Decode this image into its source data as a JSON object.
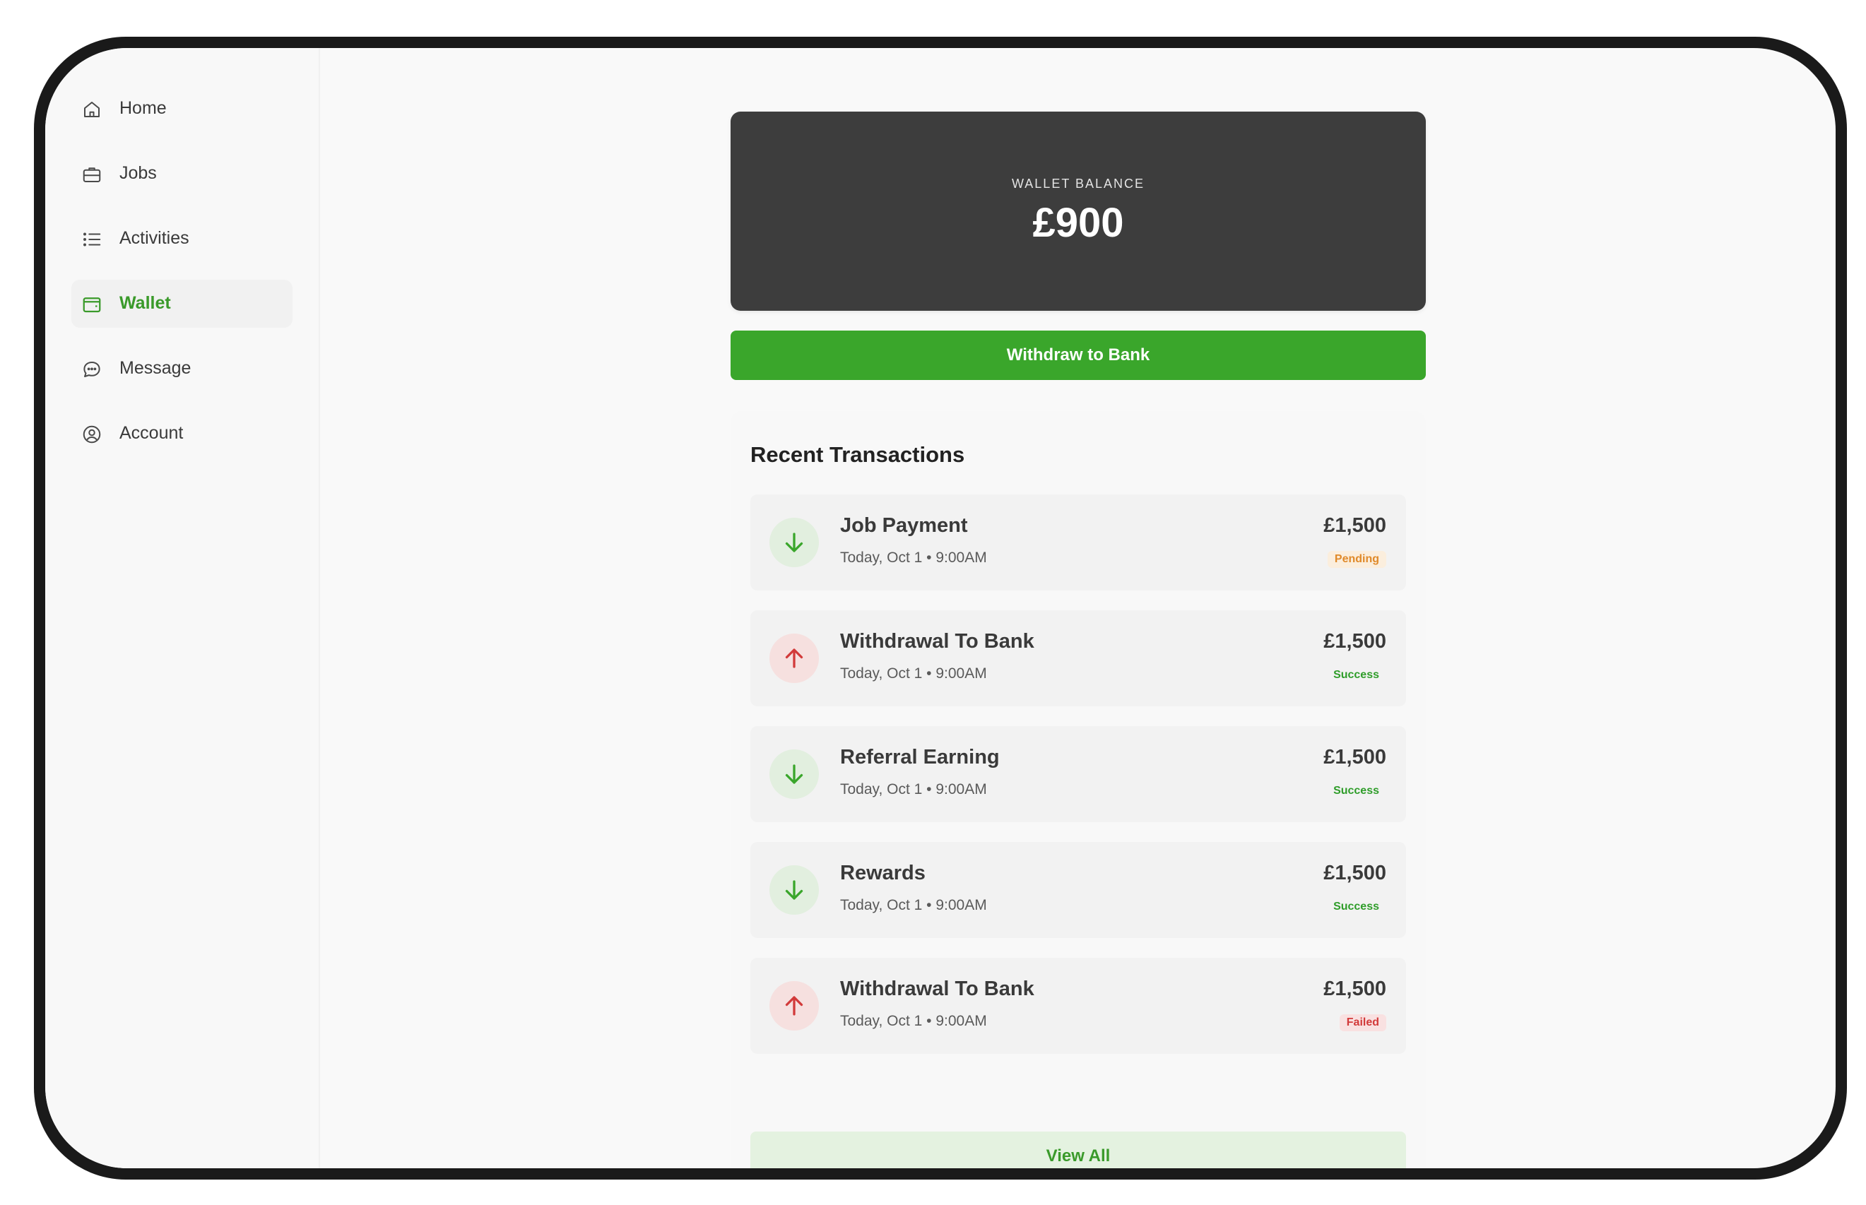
{
  "sidebar": {
    "items": [
      {
        "label": "Home",
        "icon": "home-icon",
        "active": false
      },
      {
        "label": "Jobs",
        "icon": "briefcase-icon",
        "active": false
      },
      {
        "label": "Activities",
        "icon": "list-icon",
        "active": false
      },
      {
        "label": "Wallet",
        "icon": "wallet-icon",
        "active": true
      },
      {
        "label": "Message",
        "icon": "message-icon",
        "active": false
      },
      {
        "label": "Account",
        "icon": "account-icon",
        "active": false
      }
    ]
  },
  "wallet": {
    "balance_label": "WALLET BALANCE",
    "balance": "£900",
    "withdraw_label": "Withdraw to Bank"
  },
  "transactions": {
    "title": "Recent Transactions",
    "items": [
      {
        "name": "Job Payment",
        "date": "Today, Oct 1 • 9:00AM",
        "amount": "£1,500",
        "status": "Pending",
        "direction": "in"
      },
      {
        "name": "Withdrawal To Bank",
        "date": "Today, Oct 1 • 9:00AM",
        "amount": "£1,500",
        "status": "Success",
        "direction": "out"
      },
      {
        "name": "Referral Earning",
        "date": "Today, Oct 1 • 9:00AM",
        "amount": "£1,500",
        "status": "Success",
        "direction": "in"
      },
      {
        "name": "Rewards",
        "date": "Today, Oct 1 • 9:00AM",
        "amount": "£1,500",
        "status": "Success",
        "direction": "in"
      },
      {
        "name": "Withdrawal To Bank",
        "date": "Today, Oct 1 • 9:00AM",
        "amount": "£1,500",
        "status": "Failed",
        "direction": "out"
      }
    ],
    "view_all_label": "View All"
  },
  "colors": {
    "accent": "#3aa62b",
    "card_dark": "#3d3d3d",
    "pending": "#e08a2a",
    "success": "#2f9d2a",
    "failed": "#d23a3a"
  }
}
